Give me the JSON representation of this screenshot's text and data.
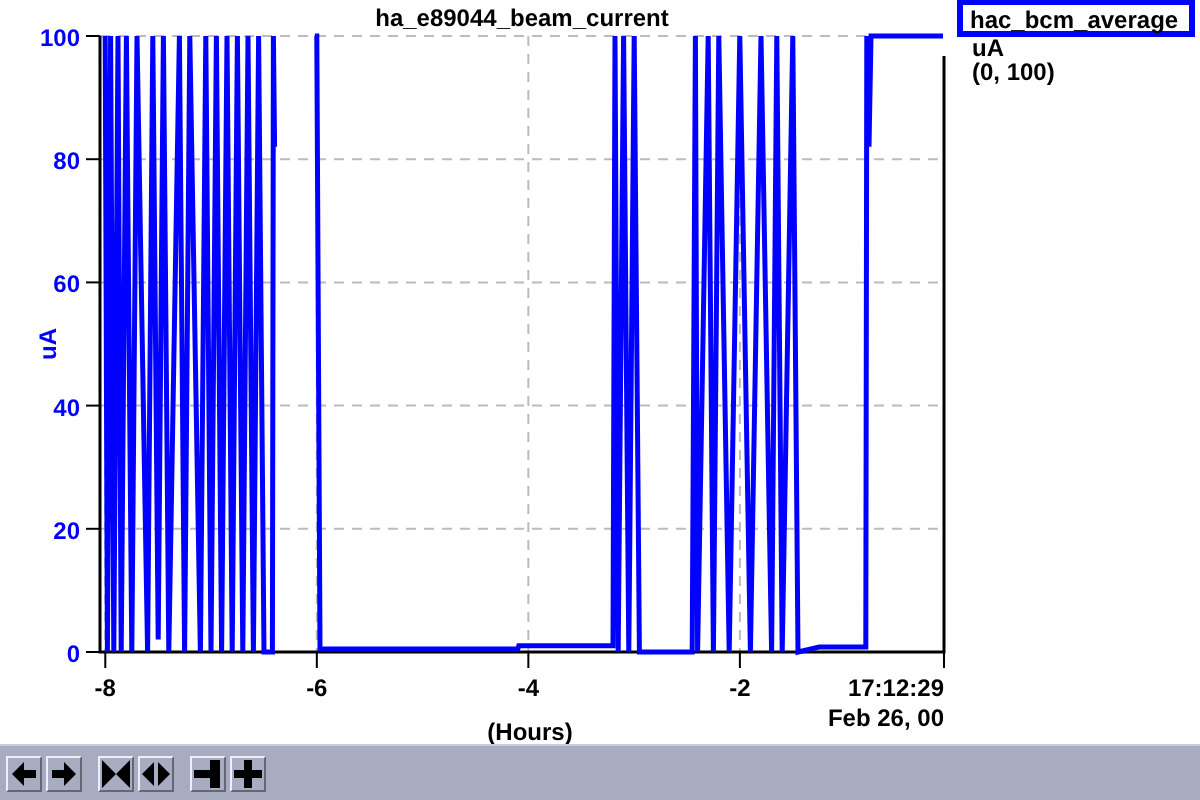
{
  "chart": {
    "time_label": "17:12:29",
    "date_label": "Feb 26, 00",
    "chart_data": {
      "type": "line",
      "title": "ha_e89044_beam_current",
      "xlabel": "(Hours)",
      "ylabel": "uA",
      "xlim": [
        -8.05,
        -0.07
      ],
      "ylim": [
        0,
        100
      ],
      "xticks": [
        -8,
        -6,
        -4,
        -2
      ],
      "yticks": [
        0,
        20,
        40,
        60,
        80,
        100
      ],
      "grid": true,
      "series": [
        {
          "name": "hac_bcm_average",
          "color": "#0000ff",
          "x": [
            -8.0,
            -7.98,
            -7.95,
            -7.92,
            -7.88,
            -7.85,
            -7.8,
            -7.75,
            -7.7,
            -7.6,
            -7.55,
            -7.5,
            -7.45,
            -7.4,
            -7.3,
            -7.25,
            -7.2,
            -7.1,
            -7.05,
            -7.0,
            -6.95,
            -6.9,
            -6.85,
            -6.8,
            -6.75,
            -6.7,
            -6.65,
            -6.6,
            -6.55,
            -6.5,
            -6.42,
            -6.41,
            -6.4,
            -6.3,
            -6.02,
            -6.0,
            -5.97,
            -4.1,
            -4.09,
            -3.2,
            -3.18,
            -3.15,
            -3.1,
            -3.05,
            -3.0,
            -2.95,
            -2.85,
            -2.45,
            -2.42,
            -2.4,
            -2.3,
            -2.25,
            -2.2,
            -2.1,
            -2.0,
            -1.9,
            -1.8,
            -1.7,
            -1.65,
            -1.6,
            -1.5,
            -1.45,
            -1.25,
            -0.81,
            -0.8,
            -0.78,
            -0.76,
            -0.08
          ],
          "values": [
            100,
            0,
            100,
            0,
            100,
            0,
            100,
            0,
            100,
            0,
            100,
            2,
            100,
            0,
            100,
            0,
            100,
            0,
            100,
            0,
            100,
            0,
            100,
            0,
            100,
            0,
            100,
            0,
            100,
            0,
            0,
            100,
            82,
            null,
            100,
            100,
            0.5,
            0.5,
            1,
            1,
            100,
            0,
            100,
            0,
            100,
            0,
            0,
            0,
            100,
            0,
            100,
            0,
            100,
            0,
            100,
            0,
            100,
            0,
            100,
            0,
            100,
            0,
            0.8,
            0.8,
            100,
            82,
            100,
            100
          ]
        }
      ]
    }
  },
  "legend": {
    "unit": "uA",
    "range": "(0, 100)"
  },
  "toolbar": [
    {
      "kind": "left"
    },
    {
      "kind": "right"
    },
    {
      "kind": "zoom-in"
    },
    {
      "kind": "zoom-out"
    },
    {
      "kind": "minus"
    },
    {
      "kind": "plus"
    }
  ]
}
